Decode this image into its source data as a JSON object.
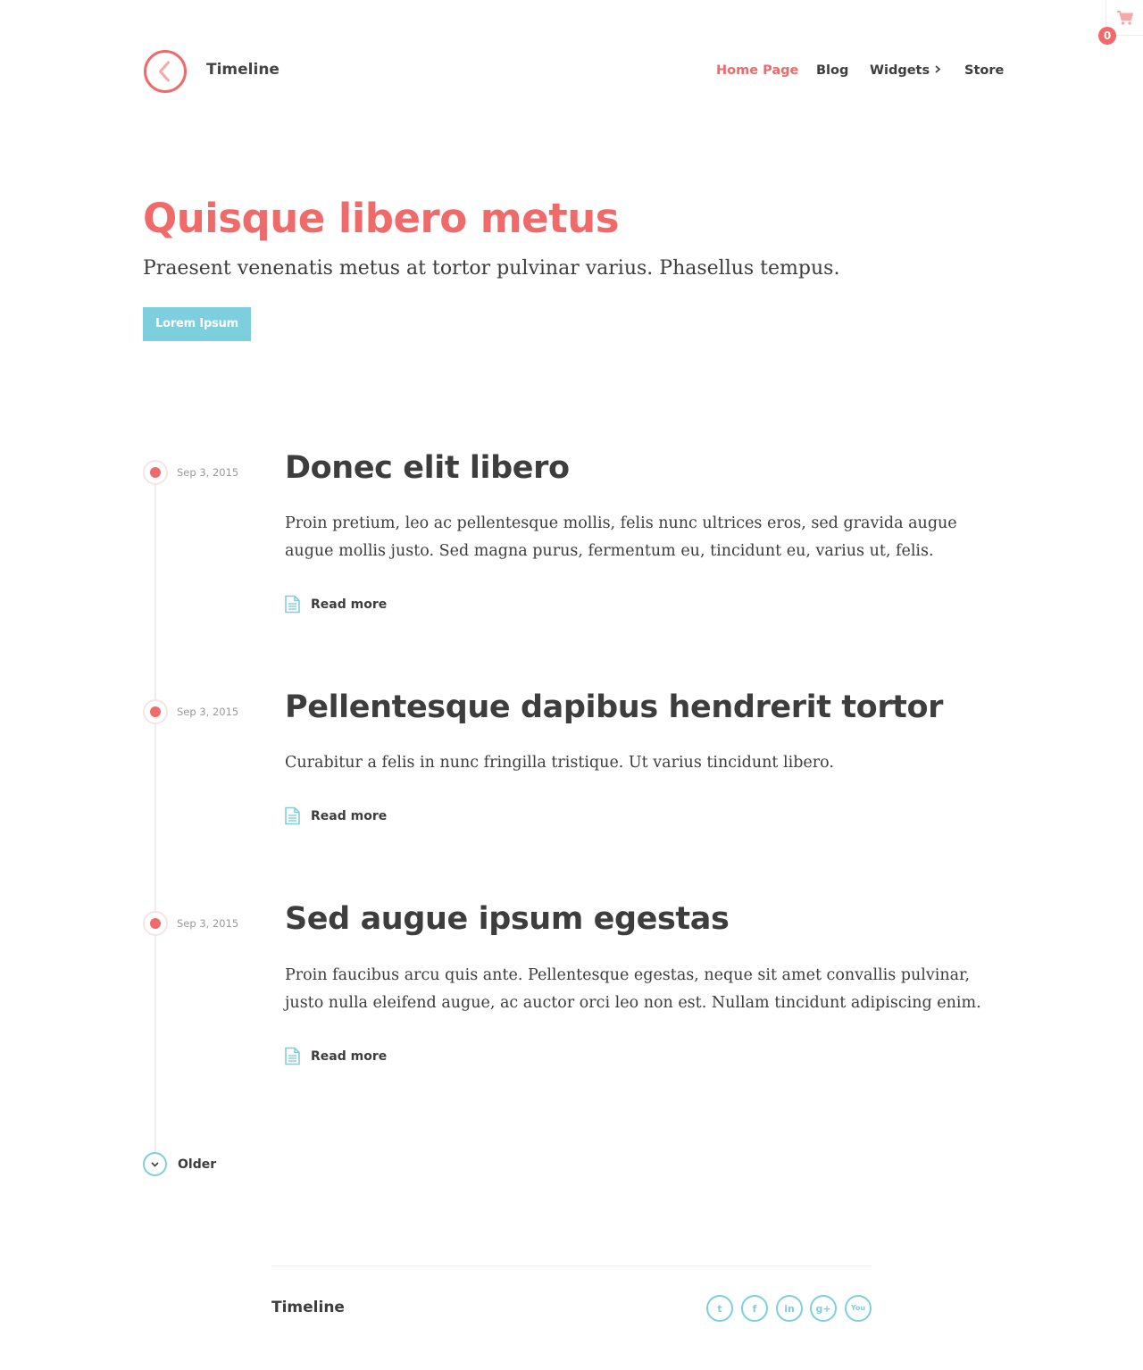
{
  "cart": {
    "count": "0",
    "icon": "cart-icon"
  },
  "header": {
    "site_title": "Timeline",
    "logo_icon": "chevron-left-circle-icon",
    "nav": [
      {
        "label": "Home Page",
        "active": true
      },
      {
        "label": "Blog"
      },
      {
        "label": "Widgets",
        "has_submenu": true
      },
      {
        "label": "Store"
      }
    ]
  },
  "hero": {
    "title": "Quisque libero metus",
    "subtitle": "Praesent venenatis metus at tortor pulvinar varius. Phasellus tempus.",
    "button_label": "Lorem Ipsum"
  },
  "posts": [
    {
      "date": "Sep 3, 2015",
      "title": "Donec elit libero",
      "excerpt": "Proin pretium, leo ac pellentesque mollis, felis nunc ultrices eros, sed gravida augue augue mollis justo. Sed magna purus, fermentum eu, tincidunt eu, varius ut, felis.",
      "read_more": "Read more"
    },
    {
      "date": "Sep 3, 2015",
      "title": "Pellentesque dapibus hendrerit tortor",
      "excerpt": "Curabitur a felis in nunc fringilla tristique. Ut varius tincidunt libero.",
      "read_more": "Read more"
    },
    {
      "date": "Sep 3, 2015",
      "title": "Sed augue ipsum egestas",
      "excerpt": "Proin faucibus arcu quis ante. Pellentesque egestas, neque sit amet convallis pulvinar, justo nulla eleifend augue, ac auctor orci leo non est. Nullam tincidunt adipiscing enim.",
      "read_more": "Read more"
    }
  ],
  "pagination": {
    "older_label": "Older"
  },
  "footer": {
    "title": "Timeline",
    "social": [
      {
        "name": "twitter-icon",
        "glyph": "t"
      },
      {
        "name": "facebook-icon",
        "glyph": "f"
      },
      {
        "name": "linkedin-icon",
        "glyph": "in"
      },
      {
        "name": "google-plus-icon",
        "glyph": "g+"
      },
      {
        "name": "youtube-icon",
        "glyph": "You"
      }
    ]
  },
  "colors": {
    "accent": "#f06a6a",
    "secondary": "#7ecfde",
    "text": "#3d3d3d",
    "muted": "#9a9a9a",
    "rule": "#eeeeee"
  }
}
